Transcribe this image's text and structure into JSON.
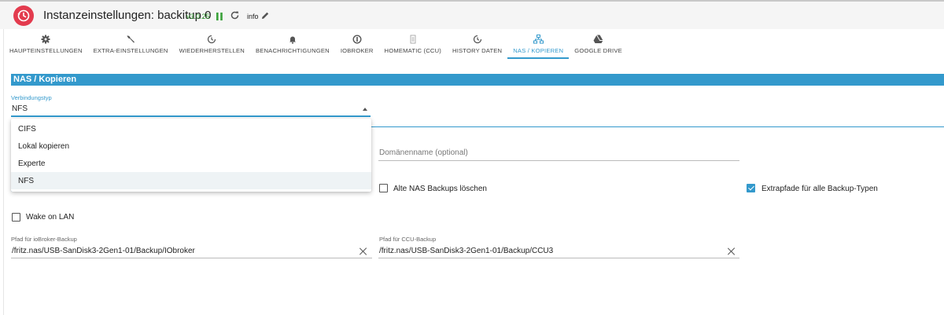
{
  "header": {
    "title": "Instanzeinstellungen: backitup.0",
    "version": "v3.0.25",
    "info_label": "info",
    "logo_icon": "backup-clock-icon",
    "accent": "#e33b4e"
  },
  "tabs": [
    {
      "label": "HAUPTEINSTELLUNGEN",
      "icon": "gear-icon"
    },
    {
      "label": "EXTRA-EINSTELLUNGEN",
      "icon": "wrench-icon"
    },
    {
      "label": "WIEDERHERSTELLEN",
      "icon": "history-icon"
    },
    {
      "label": "BENACHRICHTIGUNGEN",
      "icon": "bell-icon"
    },
    {
      "label": "IOBROKER",
      "icon": "iobroker-icon"
    },
    {
      "label": "HOMEMATIC (CCU)",
      "icon": "homematic-icon"
    },
    {
      "label": "HISTORY DATEN",
      "icon": "history-icon"
    },
    {
      "label": "NAS / KOPIEREN",
      "icon": "network-icon",
      "active": true
    },
    {
      "label": "GOOGLE DRIVE",
      "icon": "google-drive-icon"
    }
  ],
  "section": {
    "title": "NAS / Kopieren",
    "color": "#3399cc"
  },
  "connection_type": {
    "label": "Verbindungstyp",
    "value": "NFS",
    "options": [
      "CIFS",
      "Lokal kopieren",
      "Experte",
      "NFS"
    ]
  },
  "domain": {
    "placeholder": "Domänenname (optional)"
  },
  "checkboxes": {
    "delete_old": {
      "label": "Alte NAS Backups löschen",
      "checked": false
    },
    "extra_paths": {
      "label": "Extrapfade für alle Backup-Typen",
      "checked": true
    },
    "wake_on_lan": {
      "label": "Wake on LAN",
      "checked": false
    }
  },
  "paths": {
    "iobroker": {
      "label": "Pfad für ioBroker-Backup",
      "value": "/fritz.nas/USB-SanDisk3-2Gen1-01/Backup/IObroker"
    },
    "ccu": {
      "label": "Pfad für CCU-Backup",
      "value": "/fritz.nas/USB-SanDisk3-2Gen1-01/Backup/CCU3"
    }
  }
}
